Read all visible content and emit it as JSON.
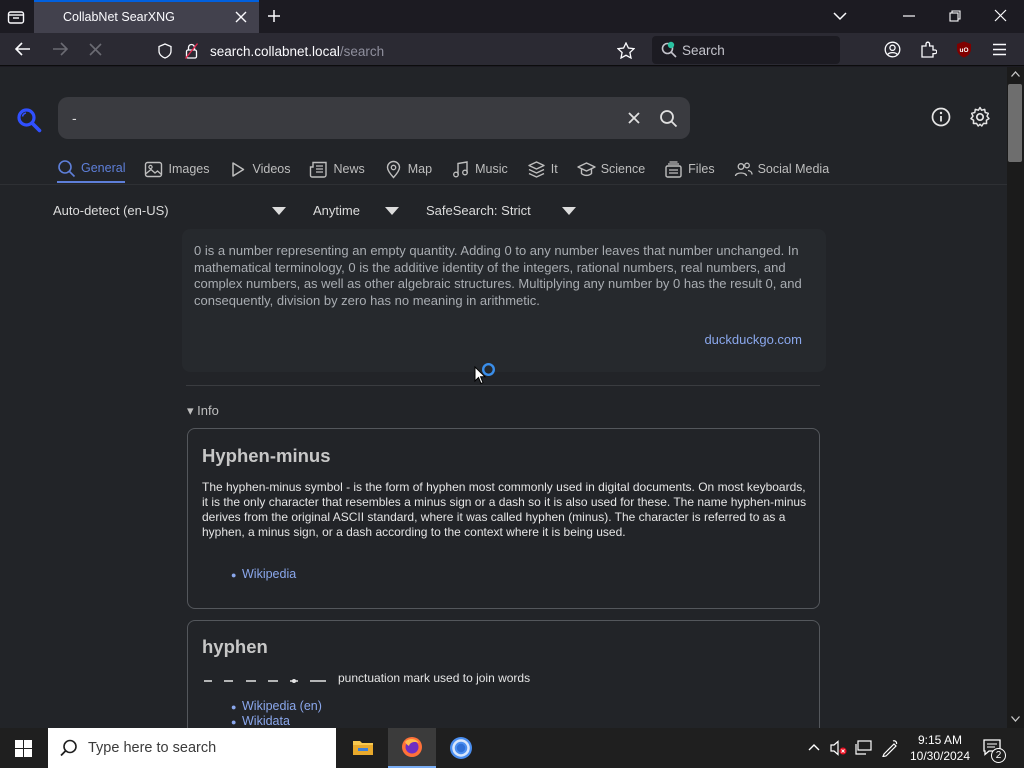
{
  "browser": {
    "tab_title": "CollabNet SearXNG",
    "url_host": "search.collabnet.local",
    "url_path": "/search",
    "searchbar_placeholder": "Search"
  },
  "search": {
    "value": "-"
  },
  "categories": [
    {
      "label": "General",
      "icon": "search-icon",
      "active": true
    },
    {
      "label": "Images",
      "icon": "image-icon"
    },
    {
      "label": "Videos",
      "icon": "play-icon"
    },
    {
      "label": "News",
      "icon": "newspaper-icon"
    },
    {
      "label": "Map",
      "icon": "map-pin-icon"
    },
    {
      "label": "Music",
      "icon": "music-note-icon"
    },
    {
      "label": "It",
      "icon": "layers-icon"
    },
    {
      "label": "Science",
      "icon": "graduation-cap-icon"
    },
    {
      "label": "Files",
      "icon": "file-stack-icon"
    },
    {
      "label": "Social Media",
      "icon": "people-icon"
    }
  ],
  "filters": {
    "language": "Auto-detect (en-US)",
    "time": "Anytime",
    "safesearch": "SafeSearch: Strict"
  },
  "answer": {
    "text": "0 is a number representing an empty quantity. Adding 0 to any number leaves that number unchanged. In mathematical terminology, 0 is the additive identity of the integers, rational numbers, real numbers, and complex numbers, as well as other algebraic structures. Multiplying any number by 0 has the result 0, and consequently, division by zero has no meaning in arithmetic.",
    "source": "duckduckgo.com"
  },
  "info": {
    "toggle": "▾ Info",
    "card1": {
      "title": "Hyphen-minus",
      "text": "The hyphen-minus symbol - is the form of hyphen most commonly used in digital documents. On most keyboards, it is the only character that resembles a minus sign or a dash so it is also used for these. The name hyphen-minus derives from the original ASCII standard, where it was called hyphen (minus). The character is referred to as a hyphen, a minus sign, or a dash according to the context where it is being used.",
      "link": "Wikipedia"
    },
    "card2": {
      "title": "hyphen",
      "description": "punctuation mark used to join words",
      "link1": "Wikipedia (en)",
      "link2": "Wikidata"
    }
  },
  "taskbar": {
    "search_placeholder": "Type here to search",
    "time": "9:15 AM",
    "date": "10/30/2024",
    "notifications": "2"
  },
  "colors": {
    "accent": "#5e7fd9",
    "link": "#8aa7ec",
    "page_bg": "#222428",
    "tab_highlight": "#0060df"
  }
}
